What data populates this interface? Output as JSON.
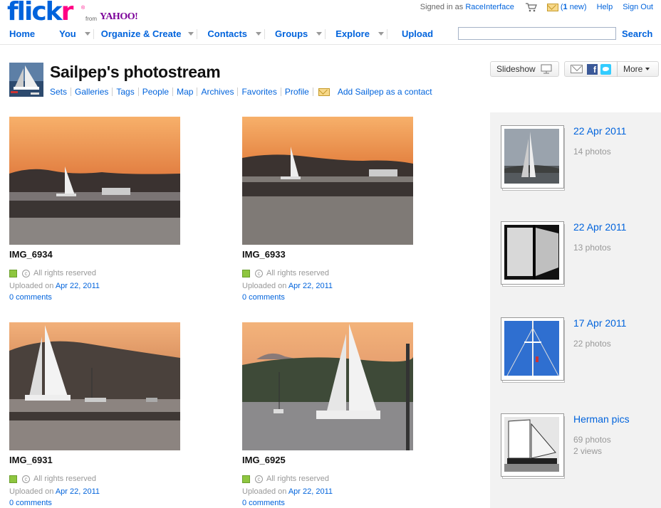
{
  "brand": {
    "logo_main": "flick",
    "logo_accent": "r",
    "logo_reg": "®",
    "logo_from": "from",
    "logo_partner": "YAHOO!"
  },
  "user_links": {
    "signed_in_prefix": "Signed in as",
    "username": "RaceInterface",
    "mail_count_number": "1",
    "mail_count_suffix": " new",
    "help": "Help",
    "sign_out": "Sign Out"
  },
  "nav": {
    "items": [
      {
        "label": "Home",
        "has_menu": false
      },
      {
        "label": "You",
        "has_menu": true
      },
      {
        "label": "Organize & Create",
        "has_menu": true
      },
      {
        "label": "Contacts",
        "has_menu": true
      },
      {
        "label": "Groups",
        "has_menu": true
      },
      {
        "label": "Explore",
        "has_menu": true
      },
      {
        "label": "Upload",
        "has_menu": false
      }
    ]
  },
  "search": {
    "value": "",
    "button_label": "Search"
  },
  "profile": {
    "title": "Sailpep's photostream",
    "sub_nav": [
      "Sets",
      "Galleries",
      "Tags",
      "People",
      "Map",
      "Archives",
      "Favorites",
      "Profile"
    ],
    "add_contact": "Add Sailpep as a contact"
  },
  "actions": {
    "slideshow": "Slideshow",
    "more": "More"
  },
  "photos": [
    {
      "title": "IMG_6934",
      "rights": "All rights reserved",
      "uploaded_prefix": "Uploaded on",
      "uploaded_date": "Apr 22, 2011",
      "comments": "0 comments"
    },
    {
      "title": "IMG_6933",
      "rights": "All rights reserved",
      "uploaded_prefix": "Uploaded on",
      "uploaded_date": "Apr 22, 2011",
      "comments": "0 comments"
    },
    {
      "title": "IMG_6931",
      "rights": "All rights reserved",
      "uploaded_prefix": "Uploaded on",
      "uploaded_date": "Apr 22, 2011",
      "comments": "0 comments"
    },
    {
      "title": "IMG_6925",
      "rights": "All rights reserved",
      "uploaded_prefix": "Uploaded on",
      "uploaded_date": "Apr 22, 2011",
      "comments": "0 comments"
    }
  ],
  "sets": [
    {
      "title": "22 Apr 2011",
      "count": "14 photos",
      "views": ""
    },
    {
      "title": "22 Apr 2011",
      "count": "13 photos",
      "views": ""
    },
    {
      "title": "17 Apr 2011",
      "count": "22 photos",
      "views": ""
    },
    {
      "title": "Herman pics",
      "count": "69 photos",
      "views": "2 views"
    }
  ],
  "colors": {
    "link": "#0063dc",
    "brand_pink": "#ff0084",
    "yahoo_purple": "#7b0099",
    "sidebar_bg": "#f2f2f2",
    "sunset": "#f0a060"
  }
}
